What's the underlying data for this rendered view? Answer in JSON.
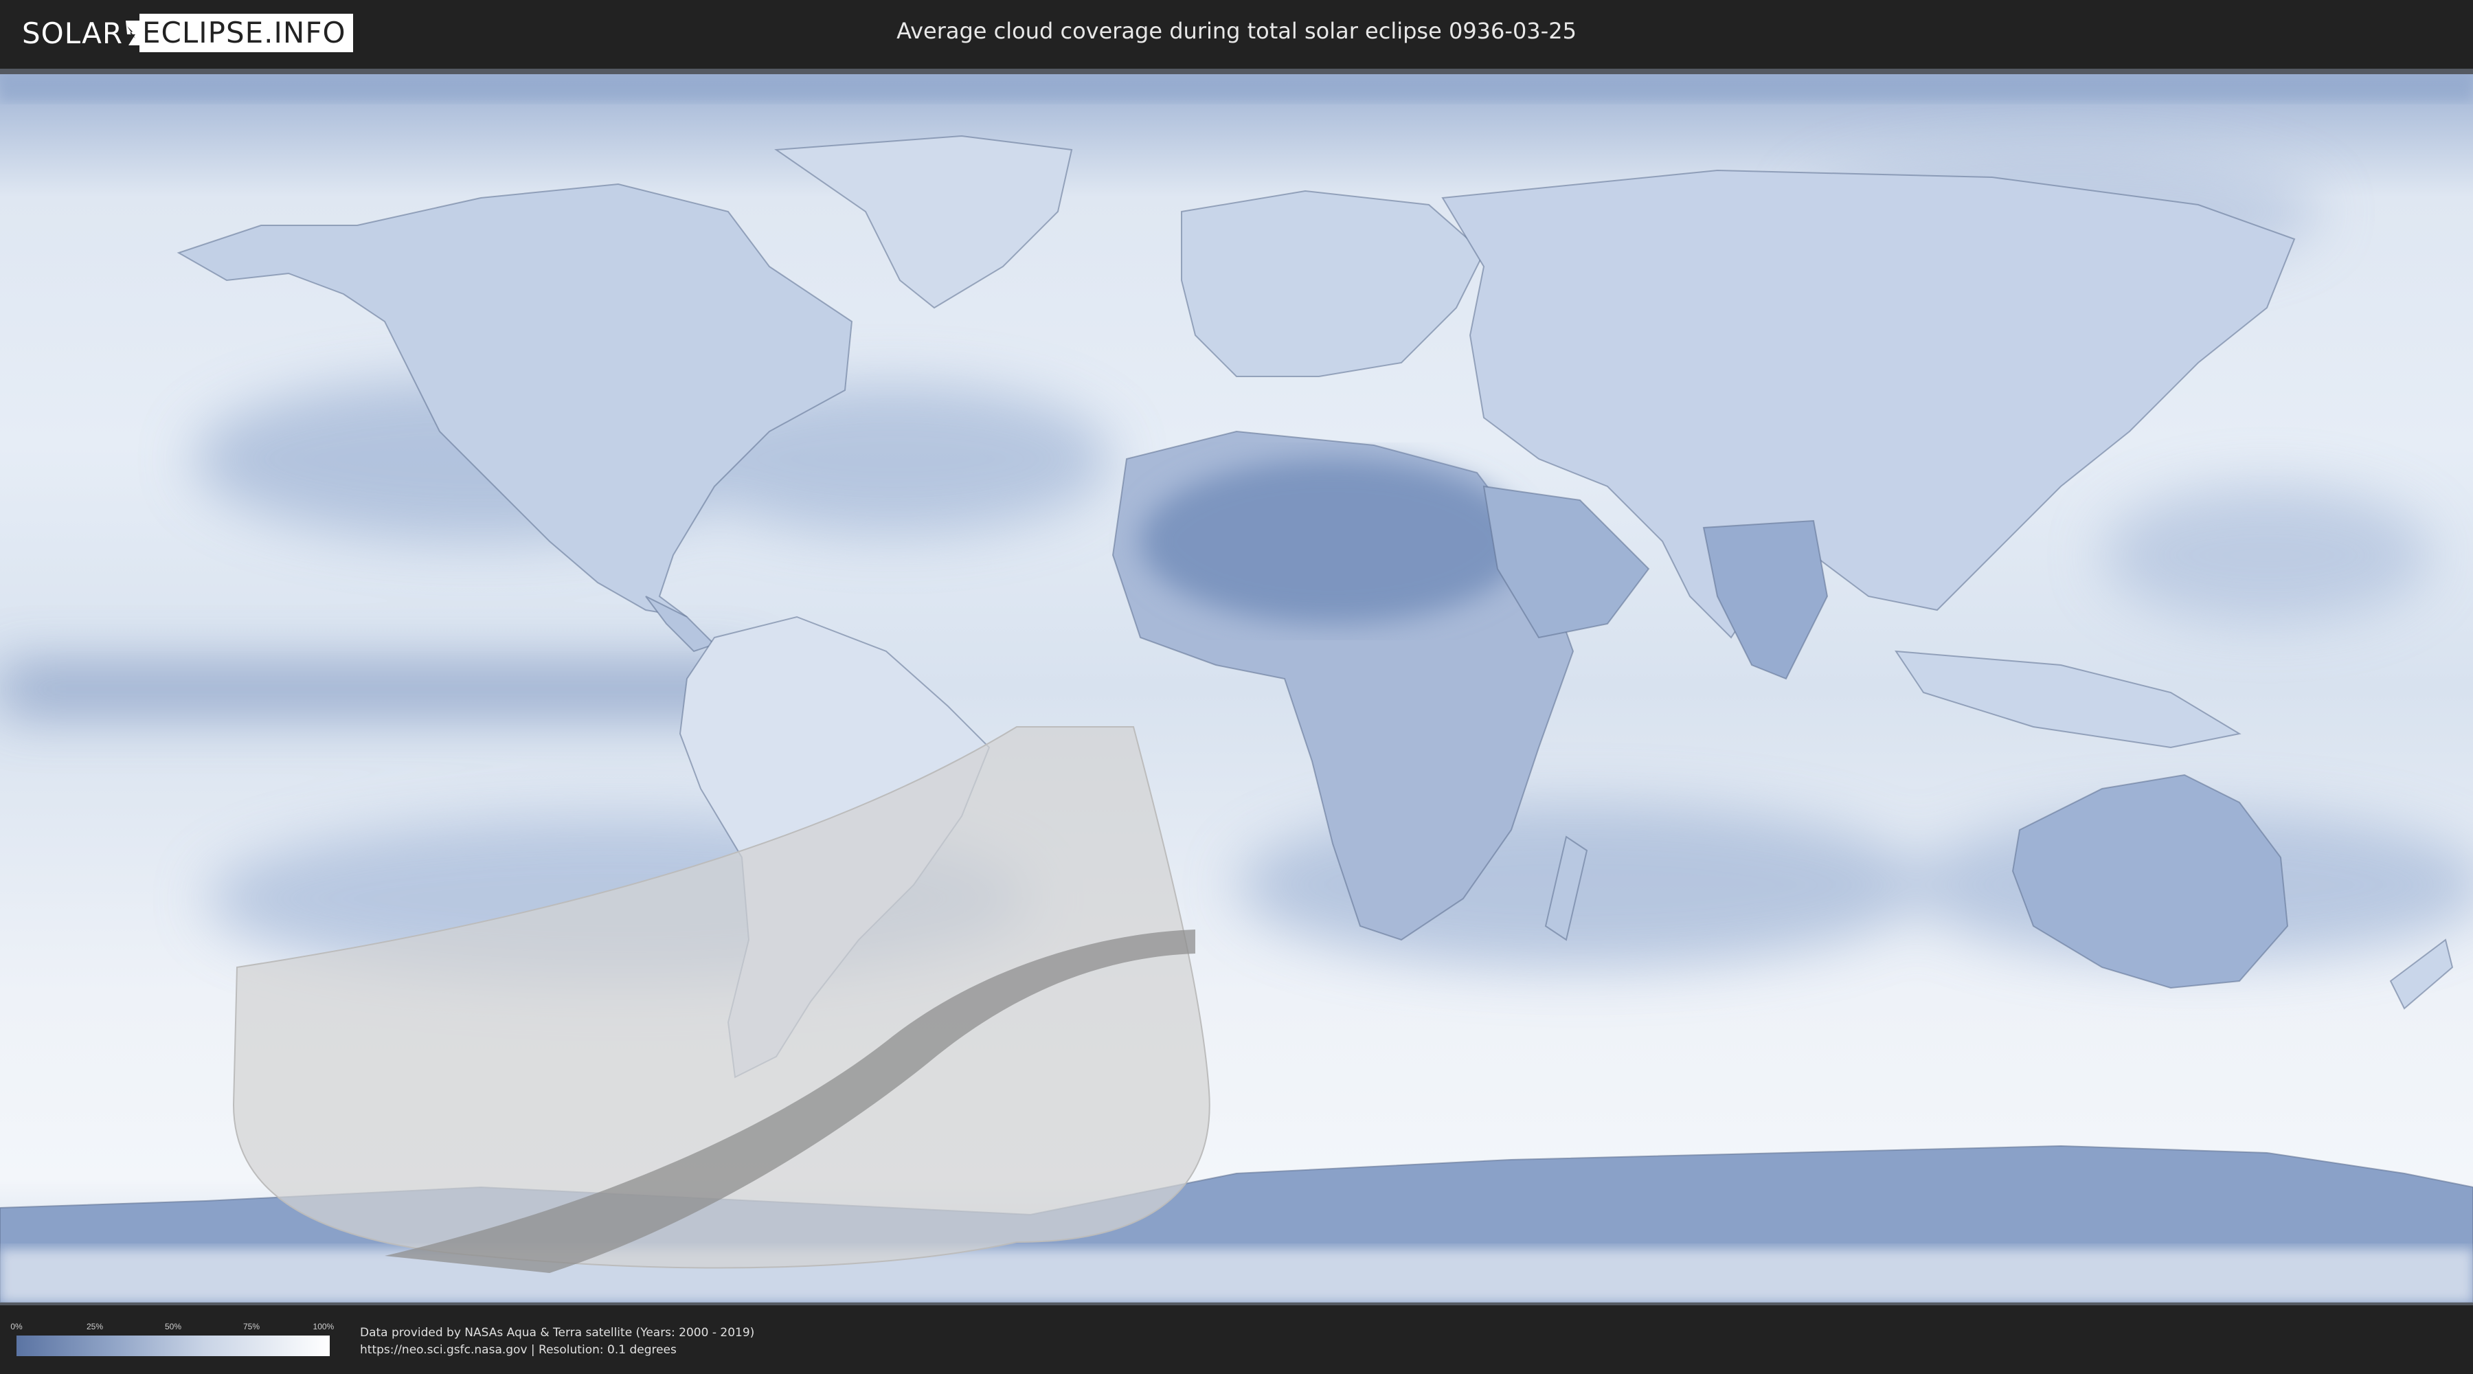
{
  "header": {
    "logo_left": "SOLAR",
    "logo_right": "ECLIPSE.INFO",
    "title": "Average cloud coverage during total solar eclipse 0936-03-25"
  },
  "legend": {
    "ticks": [
      "0%",
      "25%",
      "50%",
      "75%",
      "100%"
    ],
    "tick_fractions": [
      0,
      0.25,
      0.5,
      0.75,
      1
    ],
    "color_low": "#5b74a3",
    "color_high": "#ffffff"
  },
  "credits": {
    "line1": "Data provided by NASAs Aqua & Terra satellite (Years: 2000 - 2019)",
    "line2": "https://neo.sci.gsfc.nasa.gov | Resolution: 0.1 degrees"
  },
  "map": {
    "projection": "equirectangular",
    "colors": {
      "clear_sky": "#6d86b3",
      "cloudy": "#f4f7fb",
      "land_outline": "#4c5f80",
      "eclipse_partial_zone": "#d3d3d3",
      "eclipse_totality_path": "#8f8f8f"
    },
    "eclipse": {
      "date": "0936-03-25",
      "type": "total"
    }
  }
}
